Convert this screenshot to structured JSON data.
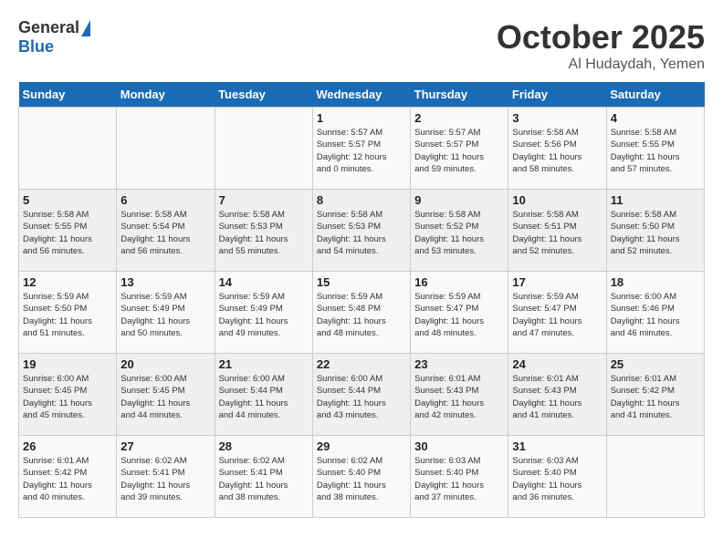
{
  "header": {
    "logo_general": "General",
    "logo_blue": "Blue",
    "title": "October 2025",
    "location": "Al Hudaydah, Yemen"
  },
  "weekdays": [
    "Sunday",
    "Monday",
    "Tuesday",
    "Wednesday",
    "Thursday",
    "Friday",
    "Saturday"
  ],
  "weeks": [
    [
      {
        "day": "",
        "info": ""
      },
      {
        "day": "",
        "info": ""
      },
      {
        "day": "",
        "info": ""
      },
      {
        "day": "1",
        "info": "Sunrise: 5:57 AM\nSunset: 5:57 PM\nDaylight: 12 hours\nand 0 minutes."
      },
      {
        "day": "2",
        "info": "Sunrise: 5:57 AM\nSunset: 5:57 PM\nDaylight: 11 hours\nand 59 minutes."
      },
      {
        "day": "3",
        "info": "Sunrise: 5:58 AM\nSunset: 5:56 PM\nDaylight: 11 hours\nand 58 minutes."
      },
      {
        "day": "4",
        "info": "Sunrise: 5:58 AM\nSunset: 5:55 PM\nDaylight: 11 hours\nand 57 minutes."
      }
    ],
    [
      {
        "day": "5",
        "info": "Sunrise: 5:58 AM\nSunset: 5:55 PM\nDaylight: 11 hours\nand 56 minutes."
      },
      {
        "day": "6",
        "info": "Sunrise: 5:58 AM\nSunset: 5:54 PM\nDaylight: 11 hours\nand 56 minutes."
      },
      {
        "day": "7",
        "info": "Sunrise: 5:58 AM\nSunset: 5:53 PM\nDaylight: 11 hours\nand 55 minutes."
      },
      {
        "day": "8",
        "info": "Sunrise: 5:58 AM\nSunset: 5:53 PM\nDaylight: 11 hours\nand 54 minutes."
      },
      {
        "day": "9",
        "info": "Sunrise: 5:58 AM\nSunset: 5:52 PM\nDaylight: 11 hours\nand 53 minutes."
      },
      {
        "day": "10",
        "info": "Sunrise: 5:58 AM\nSunset: 5:51 PM\nDaylight: 11 hours\nand 52 minutes."
      },
      {
        "day": "11",
        "info": "Sunrise: 5:58 AM\nSunset: 5:50 PM\nDaylight: 11 hours\nand 52 minutes."
      }
    ],
    [
      {
        "day": "12",
        "info": "Sunrise: 5:59 AM\nSunset: 5:50 PM\nDaylight: 11 hours\nand 51 minutes."
      },
      {
        "day": "13",
        "info": "Sunrise: 5:59 AM\nSunset: 5:49 PM\nDaylight: 11 hours\nand 50 minutes."
      },
      {
        "day": "14",
        "info": "Sunrise: 5:59 AM\nSunset: 5:49 PM\nDaylight: 11 hours\nand 49 minutes."
      },
      {
        "day": "15",
        "info": "Sunrise: 5:59 AM\nSunset: 5:48 PM\nDaylight: 11 hours\nand 48 minutes."
      },
      {
        "day": "16",
        "info": "Sunrise: 5:59 AM\nSunset: 5:47 PM\nDaylight: 11 hours\nand 48 minutes."
      },
      {
        "day": "17",
        "info": "Sunrise: 5:59 AM\nSunset: 5:47 PM\nDaylight: 11 hours\nand 47 minutes."
      },
      {
        "day": "18",
        "info": "Sunrise: 6:00 AM\nSunset: 5:46 PM\nDaylight: 11 hours\nand 46 minutes."
      }
    ],
    [
      {
        "day": "19",
        "info": "Sunrise: 6:00 AM\nSunset: 5:45 PM\nDaylight: 11 hours\nand 45 minutes."
      },
      {
        "day": "20",
        "info": "Sunrise: 6:00 AM\nSunset: 5:45 PM\nDaylight: 11 hours\nand 44 minutes."
      },
      {
        "day": "21",
        "info": "Sunrise: 6:00 AM\nSunset: 5:44 PM\nDaylight: 11 hours\nand 44 minutes."
      },
      {
        "day": "22",
        "info": "Sunrise: 6:00 AM\nSunset: 5:44 PM\nDaylight: 11 hours\nand 43 minutes."
      },
      {
        "day": "23",
        "info": "Sunrise: 6:01 AM\nSunset: 5:43 PM\nDaylight: 11 hours\nand 42 minutes."
      },
      {
        "day": "24",
        "info": "Sunrise: 6:01 AM\nSunset: 5:43 PM\nDaylight: 11 hours\nand 41 minutes."
      },
      {
        "day": "25",
        "info": "Sunrise: 6:01 AM\nSunset: 5:42 PM\nDaylight: 11 hours\nand 41 minutes."
      }
    ],
    [
      {
        "day": "26",
        "info": "Sunrise: 6:01 AM\nSunset: 5:42 PM\nDaylight: 11 hours\nand 40 minutes."
      },
      {
        "day": "27",
        "info": "Sunrise: 6:02 AM\nSunset: 5:41 PM\nDaylight: 11 hours\nand 39 minutes."
      },
      {
        "day": "28",
        "info": "Sunrise: 6:02 AM\nSunset: 5:41 PM\nDaylight: 11 hours\nand 38 minutes."
      },
      {
        "day": "29",
        "info": "Sunrise: 6:02 AM\nSunset: 5:40 PM\nDaylight: 11 hours\nand 38 minutes."
      },
      {
        "day": "30",
        "info": "Sunrise: 6:03 AM\nSunset: 5:40 PM\nDaylight: 11 hours\nand 37 minutes."
      },
      {
        "day": "31",
        "info": "Sunrise: 6:03 AM\nSunset: 5:40 PM\nDaylight: 11 hours\nand 36 minutes."
      },
      {
        "day": "",
        "info": ""
      }
    ]
  ]
}
